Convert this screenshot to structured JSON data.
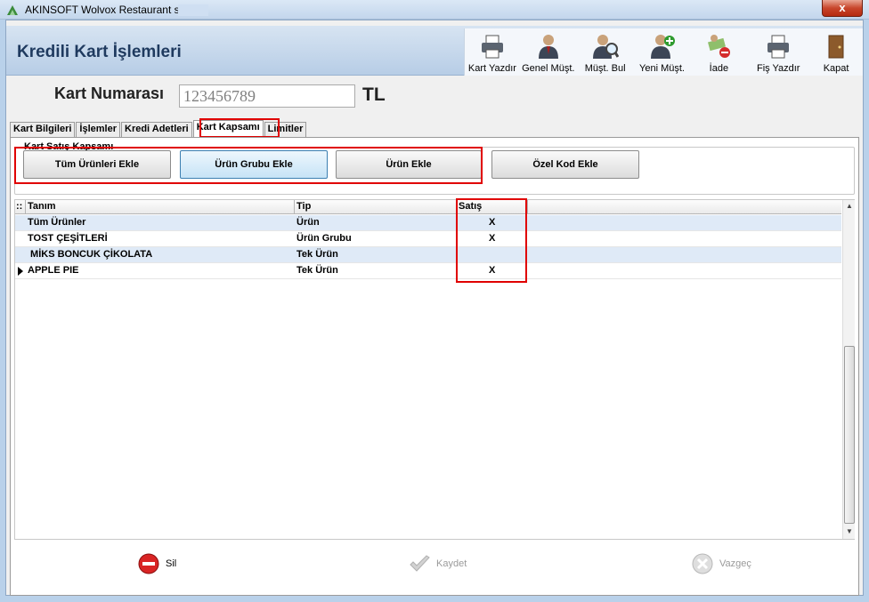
{
  "window": {
    "title": "AKINSOFT Wolvox Restaurant s",
    "close_label": "x"
  },
  "header": {
    "title": "Kredili Kart İşlemleri"
  },
  "toolbar": [
    {
      "label": "Kart Yazdır",
      "icon": "printer-icon"
    },
    {
      "label": "Genel Müşt.",
      "icon": "user-icon"
    },
    {
      "label": "Müşt. Bul",
      "icon": "user-search-icon"
    },
    {
      "label": "Yeni Müşt.",
      "icon": "user-add-icon"
    },
    {
      "label": "İade",
      "icon": "refund-icon"
    },
    {
      "label": "Fiş Yazdır",
      "icon": "printer-icon"
    },
    {
      "label": "Kapat",
      "icon": "exit-door-icon"
    }
  ],
  "card": {
    "label": "Kart Numarası",
    "value": "123456789",
    "currency": "TL"
  },
  "tabs": [
    {
      "label": "Kart Bilgileri",
      "active": false
    },
    {
      "label": "İşlemler",
      "active": false
    },
    {
      "label": "Kredi Adetleri",
      "active": false
    },
    {
      "label": "Kart Kapsamı",
      "active": true
    },
    {
      "label": "Limitler",
      "active": false
    }
  ],
  "scope": {
    "group_title": "Kart Satış Kapsamı",
    "buttons": [
      "Tüm Ürünleri Ekle",
      "Ürün Grubu Ekle",
      "Ürün Ekle",
      "Özel Kod Ekle"
    ]
  },
  "grid": {
    "columns": [
      "Tanım",
      "Tip",
      "Satış"
    ],
    "rows": [
      {
        "tanim": "Tüm Ürünler",
        "tip": "Ürün",
        "satis": "X"
      },
      {
        "tanim": "TOST ÇEŞİTLERİ",
        "tip": "Ürün Grubu",
        "satis": "X"
      },
      {
        "tanim": " MİKS BONCUK ÇİKOLATA",
        "tip": "Tek Ürün",
        "satis": ""
      },
      {
        "tanim": "APPLE PIE",
        "tip": "Tek Ürün",
        "satis": "X"
      }
    ]
  },
  "footer": {
    "delete_label": "Sil",
    "save_label": "Kaydet",
    "cancel_label": "Vazgeç"
  },
  "colors": {
    "highlight": "#e00000",
    "header_title": "#1f3a5f",
    "alt_row": "#dfeaf7"
  }
}
